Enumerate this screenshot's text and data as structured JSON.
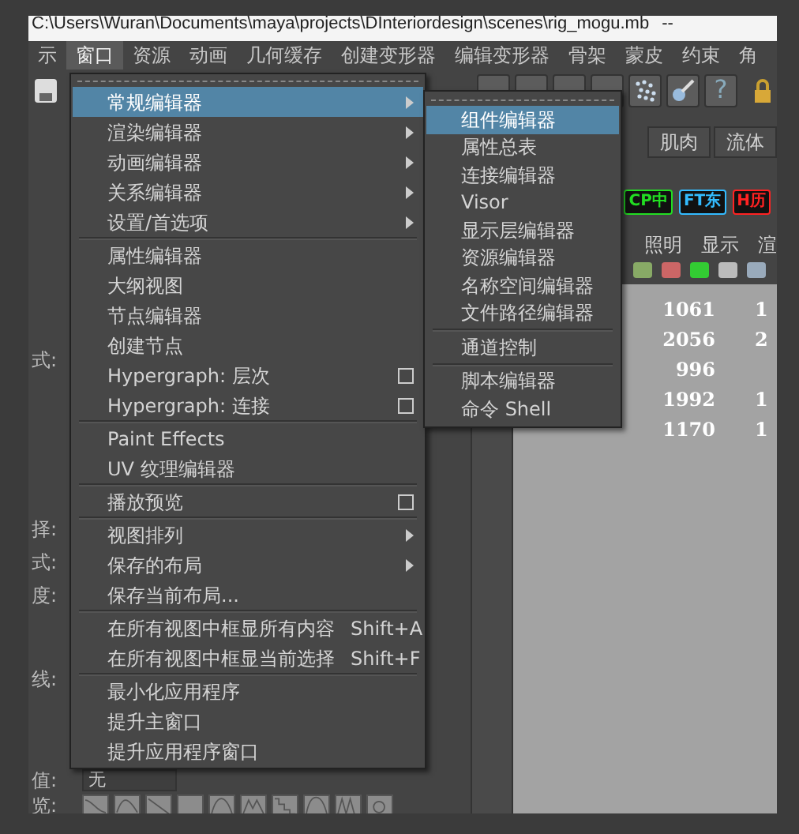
{
  "window": {
    "title": "C:\\Users\\Wuran\\Documents\\maya\\projects\\DInteriordesign\\scenes\\rig_mogu.mb",
    "title_suffix": "--"
  },
  "menubar": [
    {
      "label": "示",
      "selected": false
    },
    {
      "label": "窗口",
      "selected": true
    },
    {
      "label": "资源",
      "selected": false
    },
    {
      "label": "动画",
      "selected": false
    },
    {
      "label": "几何缓存",
      "selected": false
    },
    {
      "label": "创建变形器",
      "selected": false
    },
    {
      "label": "编辑变形器",
      "selected": false
    },
    {
      "label": "骨架",
      "selected": false
    },
    {
      "label": "蒙皮",
      "selected": false
    },
    {
      "label": "约束",
      "selected": false
    },
    {
      "label": "角",
      "selected": false
    }
  ],
  "toolbar": {
    "help_label": "?"
  },
  "shelf": {
    "tabs": [
      {
        "label": "肌肉",
        "selected": false
      },
      {
        "label": "流体",
        "selected": false
      }
    ],
    "buttons": [
      {
        "label": "CP中",
        "color": "#22dd22"
      },
      {
        "label": "FT东",
        "color": "#33bbff"
      },
      {
        "label": "H历",
        "color": "#ff2222"
      }
    ]
  },
  "panel_menu": [
    "照明",
    "显示",
    "渲"
  ],
  "stats_rows": [
    {
      "column_1": "1061",
      "column_2": "1"
    },
    {
      "column_1": "2056",
      "column_2": "2"
    },
    {
      "column_1": "996",
      "column_2": ""
    },
    {
      "column_1": "1992",
      "column_2": "1"
    },
    {
      "column_1": "1170",
      "column_2": "1"
    }
  ],
  "side_labels": [
    "式:",
    "择:",
    "式:",
    "度:",
    "线:",
    "值:",
    "览:"
  ],
  "dropdown": {
    "value": "无"
  },
  "window_menu": [
    {
      "kind": "tearoff"
    },
    {
      "kind": "item",
      "label": "常规编辑器",
      "submenu": true,
      "selected": true
    },
    {
      "kind": "item",
      "label": "渲染编辑器",
      "submenu": true,
      "selected": false
    },
    {
      "kind": "item",
      "label": "动画编辑器",
      "submenu": true,
      "selected": false
    },
    {
      "kind": "item",
      "label": "关系编辑器",
      "submenu": true,
      "selected": false
    },
    {
      "kind": "item",
      "label": "设置/首选项",
      "submenu": true,
      "selected": false
    },
    {
      "kind": "separator"
    },
    {
      "kind": "item",
      "label": "属性编辑器",
      "selected": false
    },
    {
      "kind": "item",
      "label": "大纲视图",
      "selected": false
    },
    {
      "kind": "item",
      "label": "节点编辑器",
      "selected": false
    },
    {
      "kind": "item",
      "label": "创建节点",
      "selected": false
    },
    {
      "kind": "item",
      "label": "Hypergraph: 层次",
      "option_box": true,
      "selected": false
    },
    {
      "kind": "item",
      "label": "Hypergraph: 连接",
      "option_box": true,
      "selected": false
    },
    {
      "kind": "separator"
    },
    {
      "kind": "item",
      "label": "Paint Effects",
      "selected": false
    },
    {
      "kind": "item",
      "label": "UV 纹理编辑器",
      "selected": false
    },
    {
      "kind": "separator"
    },
    {
      "kind": "item",
      "label": "播放预览",
      "option_box": true,
      "selected": false
    },
    {
      "kind": "separator"
    },
    {
      "kind": "item",
      "label": "视图排列",
      "submenu": true,
      "selected": false
    },
    {
      "kind": "item",
      "label": "保存的布局",
      "submenu": true,
      "selected": false
    },
    {
      "kind": "item",
      "label": "保存当前布局...",
      "selected": false
    },
    {
      "kind": "separator"
    },
    {
      "kind": "item",
      "label": "在所有视图中框显所有内容",
      "shortcut": "Shift+A",
      "selected": false
    },
    {
      "kind": "item",
      "label": "在所有视图中框显当前选择",
      "shortcut": "Shift+F",
      "selected": false
    },
    {
      "kind": "separator"
    },
    {
      "kind": "item",
      "label": "最小化应用程序",
      "selected": false
    },
    {
      "kind": "item",
      "label": "提升主窗口",
      "selected": false
    },
    {
      "kind": "item",
      "label": "提升应用程序窗口",
      "selected": false
    }
  ],
  "general_editors_menu": [
    {
      "kind": "tearoff"
    },
    {
      "kind": "item",
      "label": "组件编辑器",
      "selected": true
    },
    {
      "kind": "item",
      "label": "属性总表",
      "selected": false
    },
    {
      "kind": "item",
      "label": "连接编辑器",
      "selected": false
    },
    {
      "kind": "item",
      "label": "Visor",
      "selected": false
    },
    {
      "kind": "item",
      "label": "显示层编辑器",
      "selected": false
    },
    {
      "kind": "item",
      "label": "资源编辑器",
      "selected": false
    },
    {
      "kind": "item",
      "label": "名称空间编辑器",
      "selected": false
    },
    {
      "kind": "item",
      "label": "文件路径编辑器",
      "selected": false
    },
    {
      "kind": "separator"
    },
    {
      "kind": "item",
      "label": "通道控制",
      "selected": false
    },
    {
      "kind": "separator"
    },
    {
      "kind": "item",
      "label": "脚本编辑器",
      "selected": false
    },
    {
      "kind": "item",
      "label": "命令 Shell",
      "selected": false
    }
  ]
}
